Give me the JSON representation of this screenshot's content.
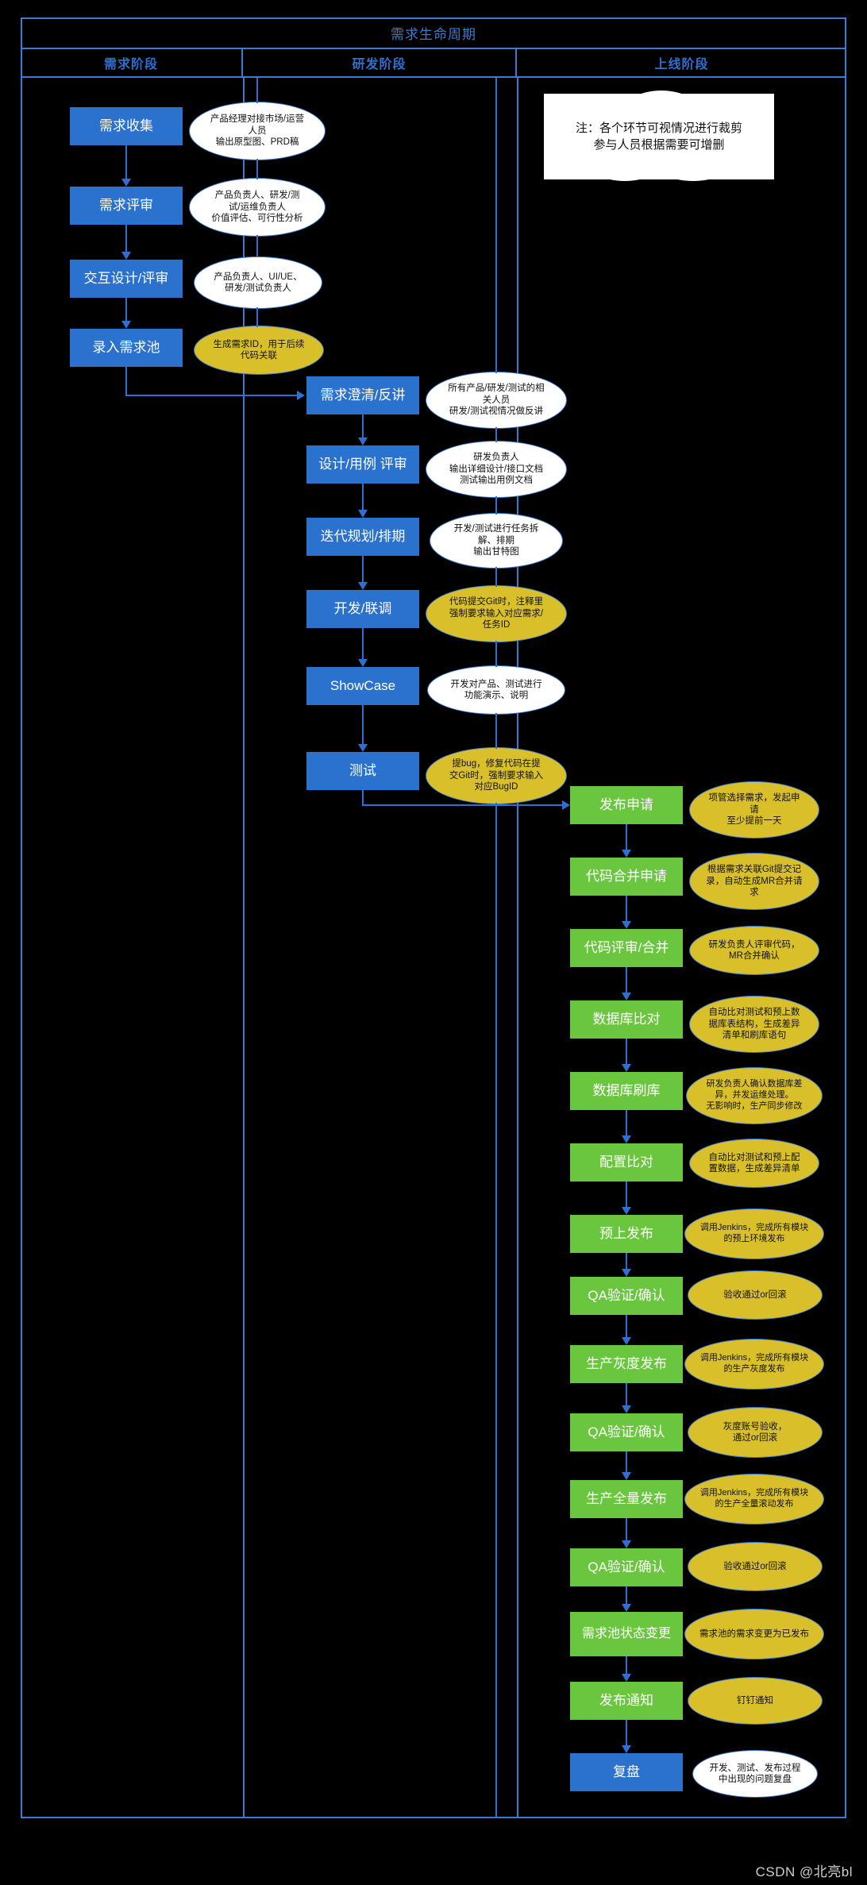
{
  "chart_title": "需求生命周期",
  "header": {
    "title": "需求生命周期",
    "columns": [
      {
        "label": "需求阶段"
      },
      {
        "label": "研发阶段"
      },
      {
        "label": "上线阶段"
      }
    ]
  },
  "note_cloud": {
    "line1": "注：各个环节可视情况进行裁剪",
    "line2": "参与人员根据需要可增删"
  },
  "colors": {
    "blue_node": "#2a72cd",
    "green_node": "#6bc63f",
    "gold_bubble": "#d9c02b",
    "white_bubble": "#ffffff",
    "line": "#2f6fd0",
    "frame": "#3a7bd5",
    "background": "#000000"
  },
  "requirement_stage": [
    {
      "node": "需求收集",
      "bubble": [
        "产品经理对接市场/运营",
        "人员",
        "输出原型图、PRD稿"
      ],
      "bubble_style": "white"
    },
    {
      "node": "需求评审",
      "bubble": [
        "产品负责人、研发/测",
        "试/运维负责人",
        "价值评估、可行性分析"
      ],
      "bubble_style": "white"
    },
    {
      "node": "交互设计/评审",
      "bubble": [
        "产品负责人、UI/UE、",
        "研发/测试负责人"
      ],
      "bubble_style": "white"
    },
    {
      "node": "录入需求池",
      "bubble": [
        "生成需求ID，用于后续",
        "代码关联"
      ],
      "bubble_style": "gold"
    }
  ],
  "development_stage": [
    {
      "node": "需求澄清/反讲",
      "bubble": [
        "所有产品/研发/测试的相",
        "关人员",
        "研发/测试视情况做反讲"
      ],
      "bubble_style": "white"
    },
    {
      "node": "设计/用例 评审",
      "bubble": [
        "研发负责人",
        "输出详细设计/接口文档",
        "测试输出用例文档"
      ],
      "bubble_style": "white"
    },
    {
      "node": "迭代规划/排期",
      "bubble": [
        "开发/测试进行任务拆",
        "解、排期",
        "输出甘特图"
      ],
      "bubble_style": "white"
    },
    {
      "node": "开发/联调",
      "bubble": [
        "代码提交Git时，注释里",
        "强制要求输入对应需求/",
        "任务ID"
      ],
      "bubble_style": "gold"
    },
    {
      "node": "ShowCase",
      "bubble": [
        "开发对产品、测试进行",
        "功能演示、说明"
      ],
      "bubble_style": "white"
    },
    {
      "node": "测试",
      "bubble": [
        "提bug，修复代码在提",
        "交Git时，强制要求输入",
        "对应BugID"
      ],
      "bubble_style": "gold"
    }
  ],
  "release_stage": [
    {
      "node": "发布申请",
      "bubble": [
        "项管选择需求，发起申",
        "请",
        "至少提前一天"
      ],
      "bubble_style": "gold",
      "node_style": "green"
    },
    {
      "node": "代码合并申请",
      "bubble": [
        "根据需求关联Git提交记",
        "录，自动生成MR合并请",
        "求"
      ],
      "bubble_style": "gold",
      "node_style": "green"
    },
    {
      "node": "代码评审/合并",
      "bubble": [
        "研发负责人评审代码，",
        "MR合并确认"
      ],
      "bubble_style": "gold",
      "node_style": "green"
    },
    {
      "node": "数据库比对",
      "bubble": [
        "自动比对测试和预上数",
        "据库表结构，生成差异",
        "清单和刷库语句"
      ],
      "bubble_style": "gold",
      "node_style": "green"
    },
    {
      "node": "数据库刷库",
      "bubble": [
        "研发负责人确认数据库差",
        "异，并发运维处理。",
        "无影响时，生产同步修改"
      ],
      "bubble_style": "gold",
      "node_style": "green"
    },
    {
      "node": "配置比对",
      "bubble": [
        "自动比对测试和预上配",
        "置数据，生成差异清单"
      ],
      "bubble_style": "gold",
      "node_style": "green"
    },
    {
      "node": "预上发布",
      "bubble": [
        "调用Jenkins，完成所有模块",
        "的预上环境发布"
      ],
      "bubble_style": "gold",
      "node_style": "green"
    },
    {
      "node": "QA验证/确认",
      "bubble": [
        "验收通过or回滚"
      ],
      "bubble_style": "gold",
      "node_style": "green"
    },
    {
      "node": "生产灰度发布",
      "bubble": [
        "调用Jenkins，完成所有模块",
        "的生产灰度发布"
      ],
      "bubble_style": "gold",
      "node_style": "green"
    },
    {
      "node": "QA验证/确认",
      "bubble": [
        "灰度账号验收，",
        "通过or回滚"
      ],
      "bubble_style": "gold",
      "node_style": "green"
    },
    {
      "node": "生产全量发布",
      "bubble": [
        "调用Jenkins，完成所有模块",
        "的生产全量滚动发布"
      ],
      "bubble_style": "gold",
      "node_style": "green"
    },
    {
      "node": "QA验证/确认",
      "bubble": [
        "验收通过or回滚"
      ],
      "bubble_style": "gold",
      "node_style": "green"
    },
    {
      "node": "需求池状态变更",
      "bubble": [
        "需求池的需求变更为已发布"
      ],
      "bubble_style": "gold",
      "node_style": "green"
    },
    {
      "node": "发布通知",
      "bubble": [
        "钉钉通知"
      ],
      "bubble_style": "gold",
      "node_style": "green"
    },
    {
      "node": "复盘",
      "bubble": [
        "开发、测试、发布过程",
        "中出现的问题复盘"
      ],
      "bubble_style": "white",
      "node_style": "blue"
    }
  ],
  "watermark": "CSDN @北亮bl"
}
